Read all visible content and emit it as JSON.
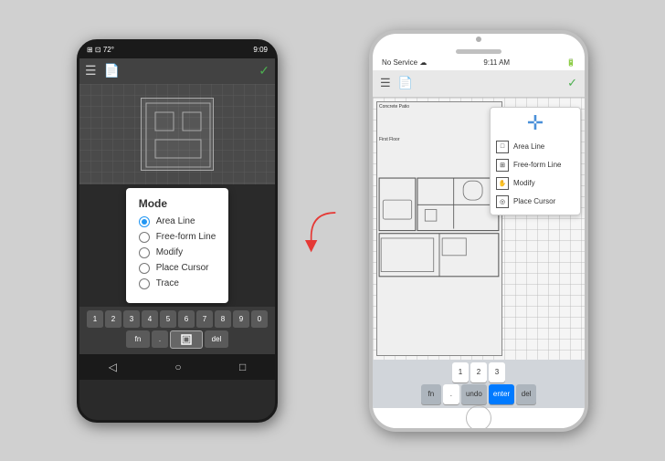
{
  "android": {
    "status": {
      "left": "⊞ ⊡ 72°",
      "right": "9:09"
    },
    "mode_dialog": {
      "title": "Mode",
      "options": [
        {
          "label": "Area Line",
          "selected": true
        },
        {
          "label": "Free-form Line",
          "selected": false
        },
        {
          "label": "Modify",
          "selected": false
        },
        {
          "label": "Place Cursor",
          "selected": false
        },
        {
          "label": "Trace",
          "selected": false
        }
      ]
    },
    "keyboard": {
      "rows": [
        [
          "1",
          "2",
          "3",
          "4",
          "5",
          "6",
          "7",
          "8",
          "9",
          "0"
        ],
        [
          "fn",
          ".",
          "□",
          "del"
        ]
      ]
    },
    "nav": [
      "◁",
      "○",
      "□"
    ]
  },
  "ios": {
    "status": {
      "left": "No Service ☁",
      "time": "9:11 AM",
      "right": "🔋"
    },
    "mode_dropdown": {
      "items": [
        {
          "label": "Area Line",
          "icon": "□"
        },
        {
          "label": "Free-form Line",
          "icon": "⊞"
        },
        {
          "label": "Modify",
          "icon": "✋"
        },
        {
          "label": "Place Cursor",
          "icon": "◎"
        }
      ]
    },
    "keyboard": {
      "num_row": [
        "1",
        "2",
        "3"
      ],
      "special": [
        "fn",
        ".",
        "undo",
        "enter",
        "del"
      ]
    }
  }
}
